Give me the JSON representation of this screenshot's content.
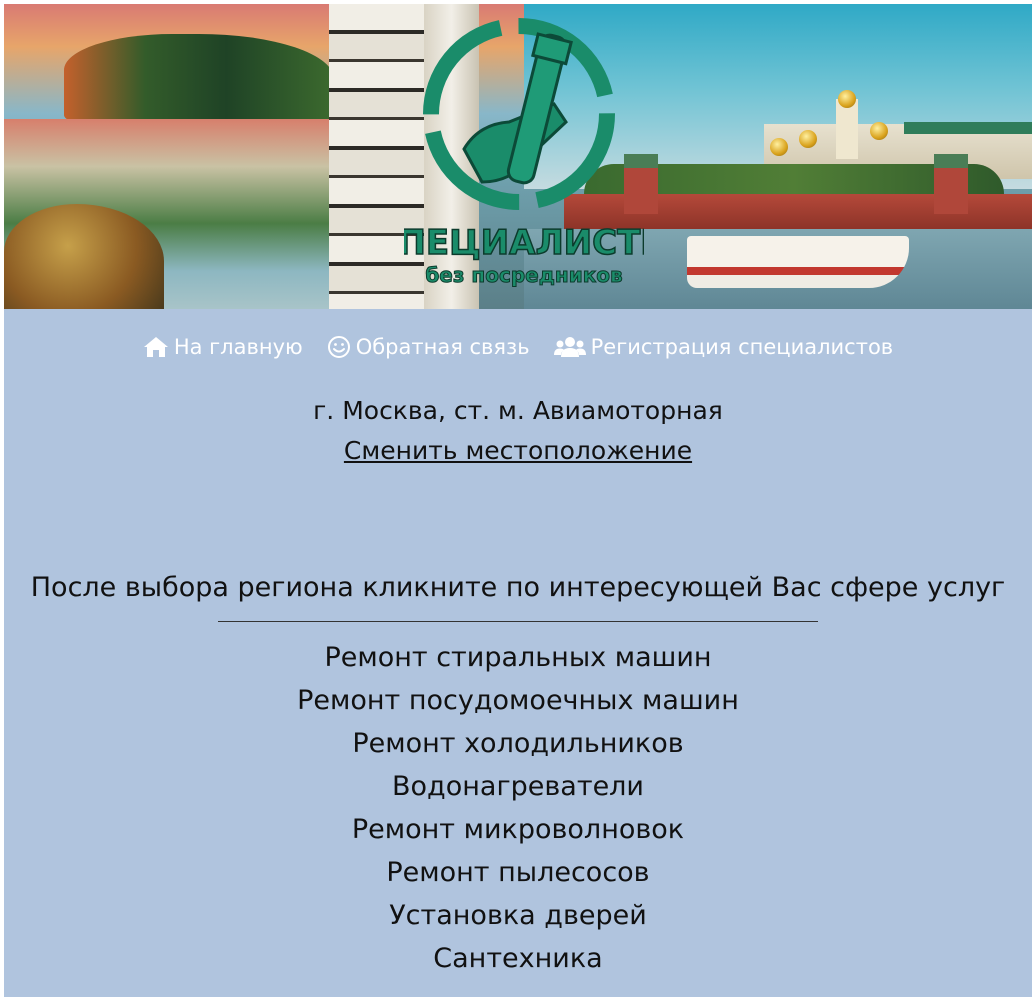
{
  "banner": {
    "logo_title": "СПЕЦИАЛИСТЫ",
    "logo_subtitle": "без посредников"
  },
  "nav": {
    "items": [
      {
        "label": "На главную",
        "icon": "home-icon"
      },
      {
        "label": "Обратная связь",
        "icon": "smile-icon"
      },
      {
        "label": "Регистрация специалистов",
        "icon": "users-icon"
      }
    ]
  },
  "location": {
    "current": "г. Москва, ст. м. Авиамоторная",
    "change_link": "Сменить местоположение"
  },
  "instruction": "После выбора региона кликните по интересующей Вас сфере услуг",
  "services": [
    "Ремонт стиральных машин",
    "Ремонт посудомоечных машин",
    "Ремонт холодильников",
    "Водонагреватели",
    "Ремонт микроволновок",
    "Ремонт пылесосов",
    "Установка дверей",
    "Сантехника"
  ],
  "colors": {
    "background": "#b0c4de",
    "nav_text": "#ffffff",
    "body_text": "#111111",
    "logo_green": "#1a8c6a"
  }
}
